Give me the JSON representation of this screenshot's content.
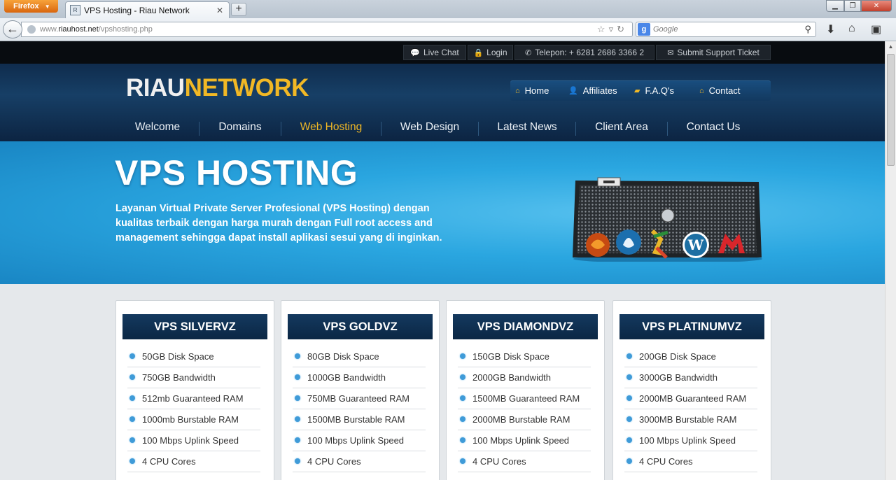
{
  "browser": {
    "app_button": "Firefox",
    "tab_title": "VPS Hosting - Riau Network",
    "new_tab_label": "+",
    "url_prefix": "www.",
    "url_domain": "riauhost.net",
    "url_path": "/vpshosting.php",
    "search_placeholder": "Google",
    "search_engine_letter": "g"
  },
  "topbar": {
    "live_chat": "Live Chat",
    "login": "Login",
    "phone": "Telepon: + 6281 2686 3366 2",
    "support": "Submit Support Ticket"
  },
  "logo": {
    "part1": "RIAU",
    "part2": "NETWORK"
  },
  "subnav": [
    {
      "label": "Home",
      "icon": "home-icon"
    },
    {
      "label": "Affiliates",
      "icon": "user-icon"
    },
    {
      "label": "F.A.Q's",
      "icon": "chat-icon"
    },
    {
      "label": "Contact",
      "icon": "home-icon"
    }
  ],
  "mainnav": [
    {
      "label": "Welcome"
    },
    {
      "label": "Domains"
    },
    {
      "label": "Web Hosting",
      "active": true
    },
    {
      "label": "Web Design"
    },
    {
      "label": "Latest News"
    },
    {
      "label": "Client Area"
    },
    {
      "label": "Contact Us"
    }
  ],
  "banner": {
    "title": "VPS HOSTING",
    "description": "Layanan Virtual Private Server Profesional (VPS Hosting) dengan kualitas terbaik dengan harga murah dengan Full root access and management sehingga dapat install aplikasi sesui yang di inginkan."
  },
  "plans": [
    {
      "name": "VPS SILVERVZ",
      "features": [
        "50GB Disk Space",
        "750GB Bandwidth",
        "512mb Guaranteed RAM",
        "1000mb Burstable RAM",
        "100 Mbps Uplink Speed",
        "4 CPU Cores"
      ]
    },
    {
      "name": "VPS GOLDVZ",
      "features": [
        "80GB Disk Space",
        "1000GB Bandwidth",
        "750MB Guaranteed RAM",
        "1500MB Burstable RAM",
        "100 Mbps Uplink Speed",
        "4 CPU Cores"
      ]
    },
    {
      "name": "VPS DIAMONDVZ",
      "features": [
        "150GB Disk Space",
        "2000GB Bandwidth",
        "1500MB Guaranteed RAM",
        "2000MB Burstable RAM",
        "100 Mbps Uplink Speed",
        "4 CPU Cores"
      ]
    },
    {
      "name": "VPS PLATINUMVZ",
      "features": [
        "200GB Disk Space",
        "3000GB Bandwidth",
        "2000MB Guaranteed RAM",
        "3000MB Burstable RAM",
        "100 Mbps Uplink Speed",
        "4 CPU Cores"
      ]
    }
  ],
  "colors": {
    "accent": "#f1b825",
    "header_dark": "#0f2c4d",
    "banner_blue": "#2aa6e0",
    "bullet": "#3f9bd8"
  }
}
